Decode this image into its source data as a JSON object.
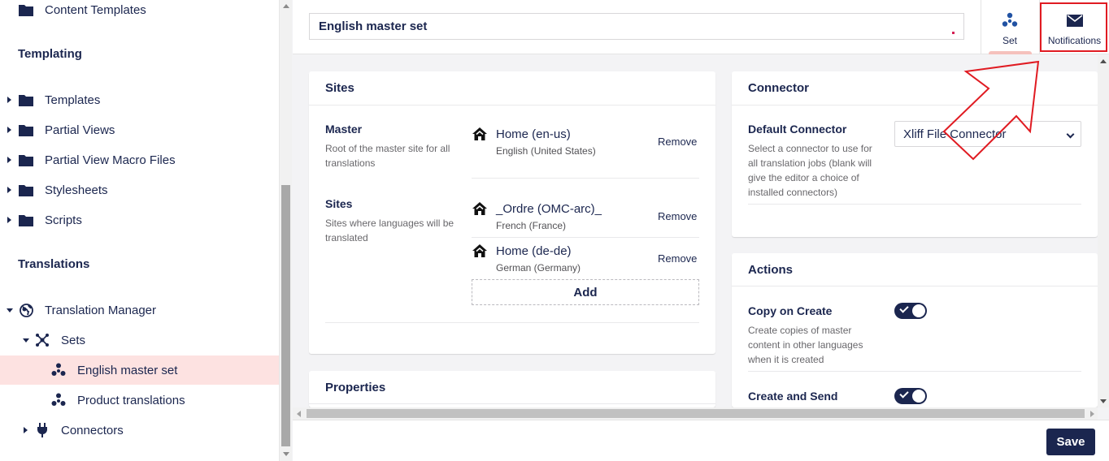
{
  "sidebar": {
    "top_item": "Content Templates",
    "section_templating": "Templating",
    "templating_items": [
      "Templates",
      "Partial Views",
      "Partial View Macro Files",
      "Stylesheets",
      "Scripts"
    ],
    "section_translations": "Translations",
    "translation_manager": "Translation Manager",
    "sets": "Sets",
    "set_items": [
      "English master set",
      "Product translations"
    ],
    "connectors": "Connectors"
  },
  "header": {
    "name_value": "English master set",
    "tab_set_label": "Set",
    "tab_notifications_label": "Notifications"
  },
  "sites_panel": {
    "title": "Sites",
    "master_label": "Master",
    "master_desc": "Root of the master site for all translations",
    "master_site": {
      "name": "Home (en-us)",
      "culture": "English (United States)",
      "remove": "Remove"
    },
    "sites_label": "Sites",
    "sites_desc": "Sites where languages will be translated",
    "sites": [
      {
        "name": "_Ordre (OMC-arc)_",
        "culture": "French (France)",
        "remove": "Remove"
      },
      {
        "name": "Home (de-de)",
        "culture": "German (Germany)",
        "remove": "Remove"
      }
    ],
    "add_label": "Add"
  },
  "properties_panel": {
    "title": "Properties"
  },
  "connector_panel": {
    "title": "Connector",
    "default_label": "Default Connector",
    "default_desc": "Select a connector to use for all translation jobs (blank will give the editor a choice of installed connectors)",
    "selected_connector": "Xliff File Connector"
  },
  "actions_panel": {
    "title": "Actions",
    "copy_label": "Copy on Create",
    "copy_desc": "Create copies of master content in other languages when it is created",
    "copy_enabled": true,
    "create_send_label": "Create and Send",
    "create_send_enabled": true
  },
  "footer": {
    "save_label": "Save"
  },
  "colors": {
    "primary": "#1b264f",
    "selected_bg": "#fde2e1",
    "accent": "#f5c1bc",
    "annotation": "#e01b22"
  }
}
